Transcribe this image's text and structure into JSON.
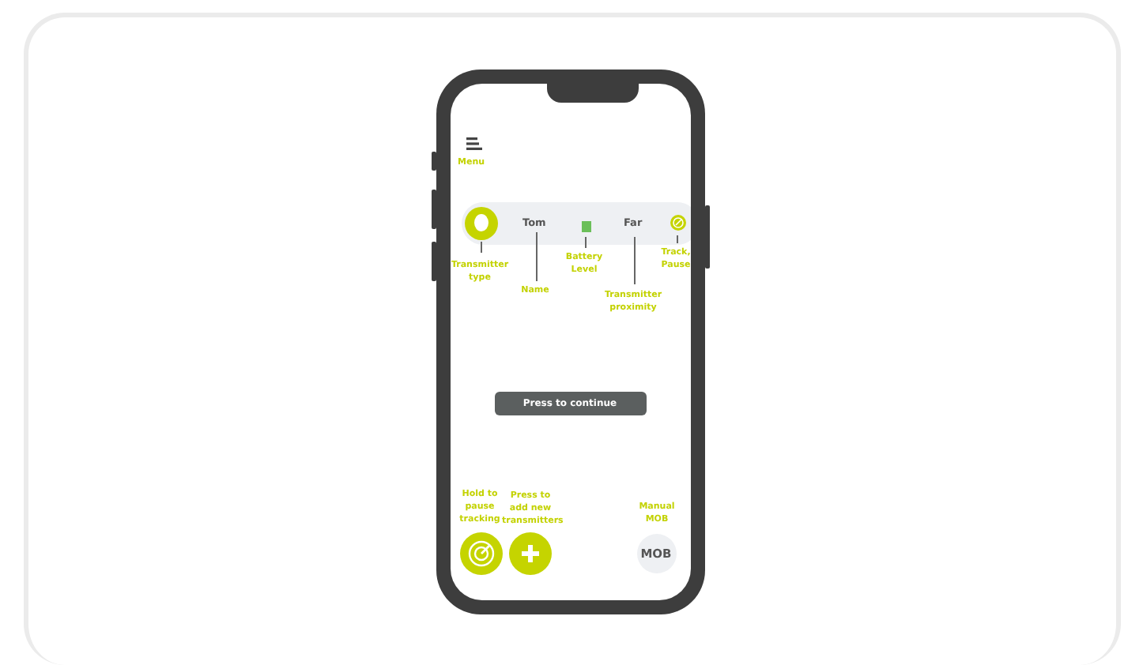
{
  "menu": {
    "label": "Menu"
  },
  "transmitter": {
    "name": "Tom",
    "battery": {
      "level": 0.6
    },
    "proximity": "Far"
  },
  "annotations": [
    {
      "kind": "type",
      "text": "Transmitter type"
    },
    {
      "kind": "name",
      "text": "Name"
    },
    {
      "kind": "battery",
      "text": "Battery Level"
    },
    {
      "kind": "proximity",
      "text": "Transmitter proximity"
    },
    {
      "kind": "track",
      "text": "Track, Pause"
    }
  ],
  "continue_button": {
    "label": "Press to continue"
  },
  "bottom_buttons": [
    {
      "kind": "pause",
      "hint": "Hold to pause tracking"
    },
    {
      "kind": "add",
      "hint": "Press to add new transmitters"
    },
    {
      "kind": "mob",
      "hint": "Manual MOB",
      "label": "MOB"
    }
  ]
}
